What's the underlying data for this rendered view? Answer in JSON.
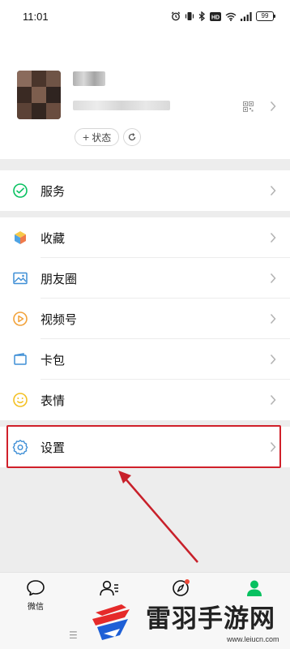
{
  "status_bar": {
    "time": "11:01",
    "battery": "99",
    "network_badge": "HD"
  },
  "profile": {
    "status_button_label": "状态",
    "status_button_icon": "plus-icon"
  },
  "menu": {
    "items": [
      {
        "label": "服务",
        "icon": "service-icon",
        "color": "#07c160"
      },
      {
        "label": "收藏",
        "icon": "favorites-cube-icon",
        "color": "#f0a02a"
      },
      {
        "label": "朋友圈",
        "icon": "moments-image-icon",
        "color": "#3f8fd6"
      },
      {
        "label": "视频号",
        "icon": "channels-play-icon",
        "color": "#f2a23a"
      },
      {
        "label": "卡包",
        "icon": "card-wallet-icon",
        "color": "#3f8fd6"
      },
      {
        "label": "表情",
        "icon": "emoji-smile-icon",
        "color": "#f3c022"
      },
      {
        "label": "设置",
        "icon": "settings-gear-icon",
        "color": "#3f8fd6"
      }
    ]
  },
  "tabs": [
    {
      "label": "微信",
      "icon": "chat-bubble-icon"
    },
    {
      "label": "",
      "icon": "contacts-icon"
    },
    {
      "label": "",
      "icon": "discover-compass-icon"
    },
    {
      "label": "",
      "icon": "me-person-icon",
      "active": true
    }
  ],
  "watermark": {
    "title": "雷羽手游网",
    "url": "www.leiucn.com"
  },
  "accent_color": "#07c160",
  "highlight_color": "#d0202a"
}
